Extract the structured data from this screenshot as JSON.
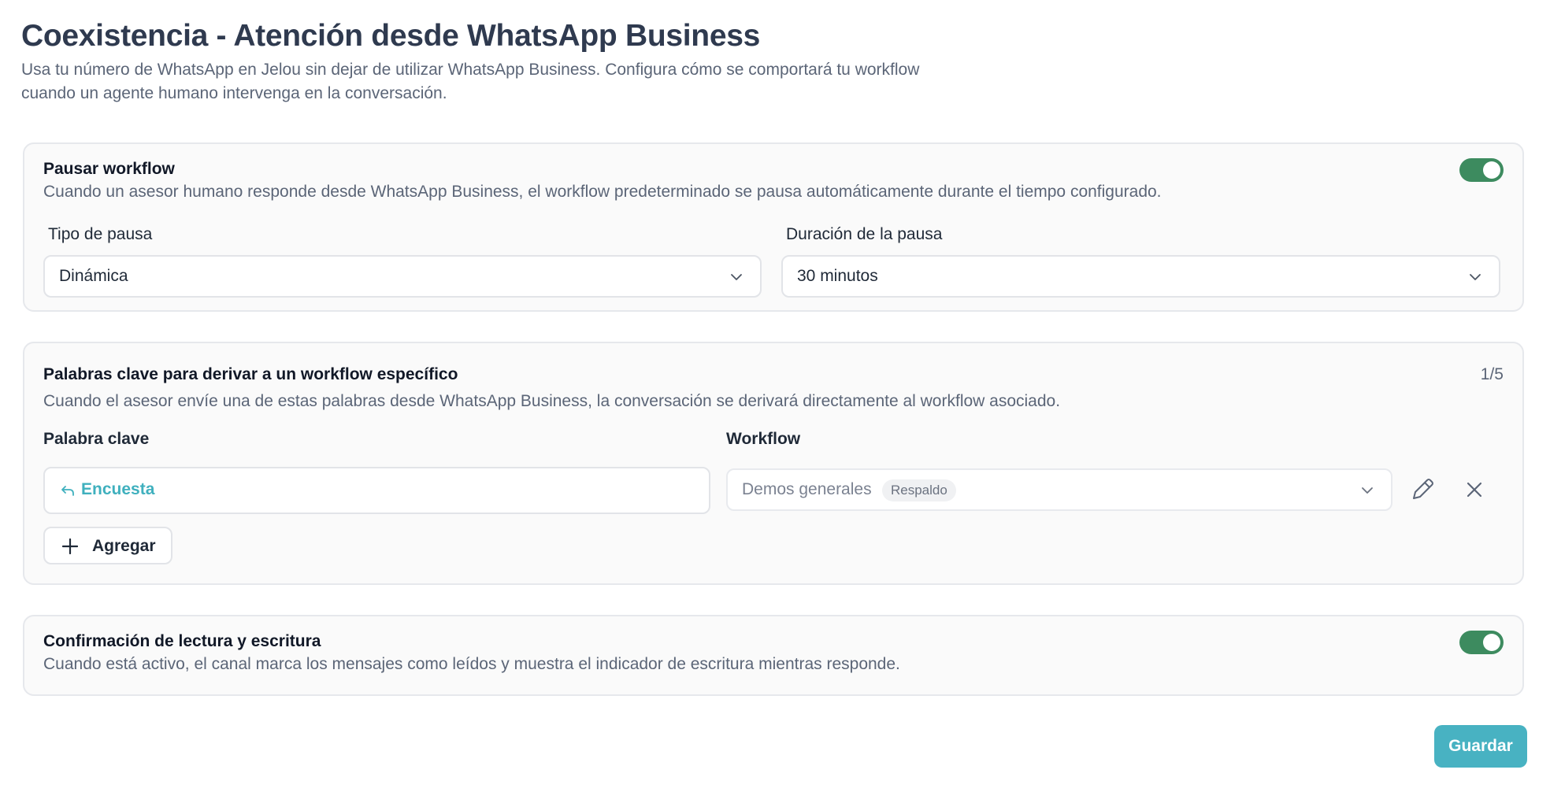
{
  "page": {
    "title": "Coexistencia - Atención desde WhatsApp Business",
    "subtitle": "Usa tu número de WhatsApp en Jelou sin dejar de utilizar WhatsApp Business. Configura cómo se comportará tu workflow cuando un agente humano intervenga en la conversación."
  },
  "pause_section": {
    "title": "Pausar workflow",
    "description": "Cuando un asesor humano responde desde WhatsApp Business, el workflow predeterminado se pausa automáticamente durante el tiempo configurado.",
    "enabled": true,
    "pause_type": {
      "label": "Tipo de pausa",
      "value": "Dinámica"
    },
    "pause_duration": {
      "label": "Duración de la pausa",
      "value": "30 minutos"
    }
  },
  "keywords_section": {
    "title": "Palabras clave para derivar a un workflow específico",
    "counter": "1/5",
    "description": "Cuando el asesor envíe una de estas palabras desde WhatsApp Business, la conversación se derivará directamente al workflow asociado.",
    "keyword_label": "Palabra clave",
    "workflow_label": "Workflow",
    "rows": [
      {
        "keyword": "Encuesta",
        "workflow": "Demos generales",
        "badge": "Respaldo"
      }
    ],
    "add_label": "Agregar"
  },
  "read_section": {
    "title": "Confirmación de lectura y escritura",
    "description": "Cuando está activo, el canal marca los mensajes como leídos y muestra el indicador de escritura mientras responde.",
    "enabled": true
  },
  "save_label": "Guardar",
  "colors": {
    "toggle_on": "#3d8b5f",
    "accent": "#48b2c2",
    "keyword_text": "#3fb0be"
  },
  "icons": [
    "chevron-down-icon",
    "reply-arrow-icon",
    "pencil-icon",
    "close-icon",
    "plus-icon"
  ]
}
